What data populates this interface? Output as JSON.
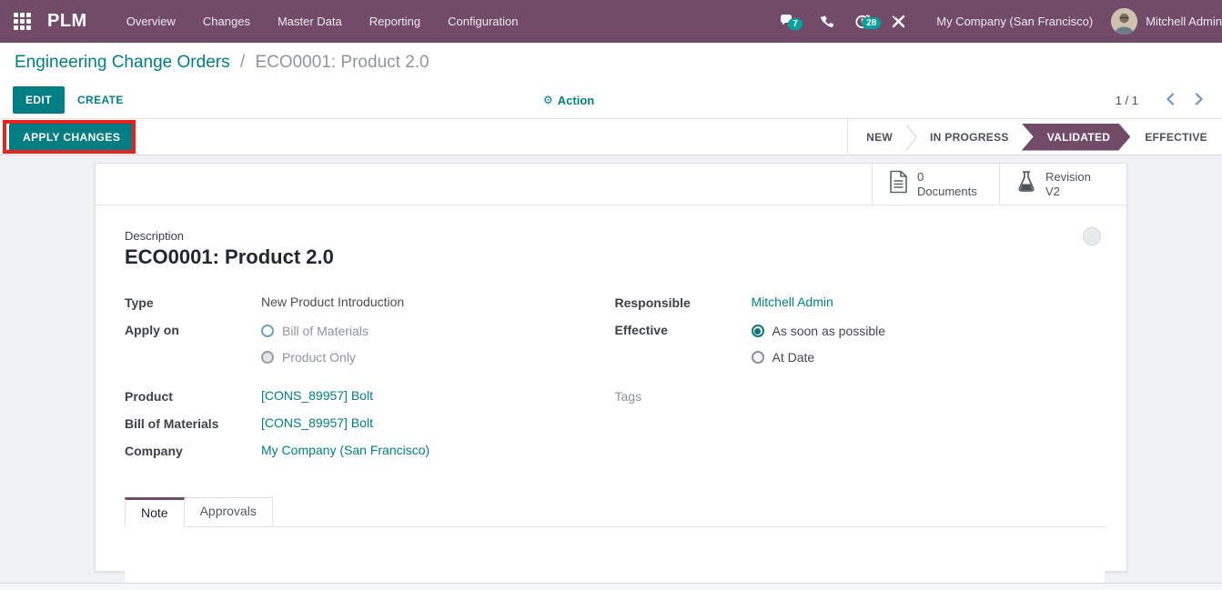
{
  "colors": {
    "navbar": "#714b67",
    "accent": "#017e84",
    "badge": "#00a09d",
    "status_active": "#714b67",
    "annotation_red": "#e8231d",
    "link": "#017e84"
  },
  "navbar": {
    "brand": "PLM",
    "menus": [
      {
        "label": "Overview"
      },
      {
        "label": "Changes"
      },
      {
        "label": "Master Data"
      },
      {
        "label": "Reporting"
      },
      {
        "label": "Configuration"
      }
    ],
    "systray": {
      "messages_badge": "7",
      "activities_badge": "28",
      "company": "My Company (San Francisco)",
      "user": "Mitchell Admin"
    }
  },
  "breadcrumb": {
    "parent": "Engineering Change Orders",
    "separator": "/",
    "current": "ECO0001: Product 2.0"
  },
  "control_panel": {
    "edit_label": "EDIT",
    "create_label": "CREATE",
    "action_label": "Action",
    "pager_value": "1 / 1"
  },
  "statusbar": {
    "apply_changes_label": "APPLY CHANGES",
    "states": [
      {
        "label": "NEW",
        "active": false
      },
      {
        "label": "IN PROGRESS",
        "active": false
      },
      {
        "label": "VALIDATED",
        "active": true
      },
      {
        "label": "EFFECTIVE",
        "active": false
      }
    ]
  },
  "stat_buttons": [
    {
      "value": "0",
      "label": "Documents",
      "icon": "document-icon"
    },
    {
      "value": "Revision",
      "label": "V2",
      "icon": "flask-icon"
    }
  ],
  "form": {
    "description_label": "Description",
    "title": "ECO0001: Product 2.0",
    "left_fields": {
      "type": {
        "label": "Type",
        "value": "New Product Introduction"
      },
      "apply_on": {
        "label": "Apply on",
        "options": [
          {
            "label": "Bill of Materials",
            "checked": false,
            "disabled": false
          },
          {
            "label": "Product Only",
            "checked": false,
            "disabled": true
          }
        ]
      },
      "product": {
        "label": "Product",
        "value": "[CONS_89957] Bolt"
      },
      "bom": {
        "label": "Bill of Materials",
        "value": "[CONS_89957] Bolt"
      },
      "company": {
        "label": "Company",
        "value": "My Company (San Francisco)"
      }
    },
    "right_fields": {
      "responsible": {
        "label": "Responsible",
        "value": "Mitchell Admin"
      },
      "effective": {
        "label": "Effective",
        "options": [
          {
            "label": "As soon as possible",
            "checked": true
          },
          {
            "label": "At Date",
            "checked": false
          }
        ]
      },
      "tags": {
        "label": "Tags",
        "value": ""
      }
    },
    "tabs": [
      {
        "label": "Note",
        "active": true
      },
      {
        "label": "Approvals",
        "active": false
      }
    ]
  }
}
